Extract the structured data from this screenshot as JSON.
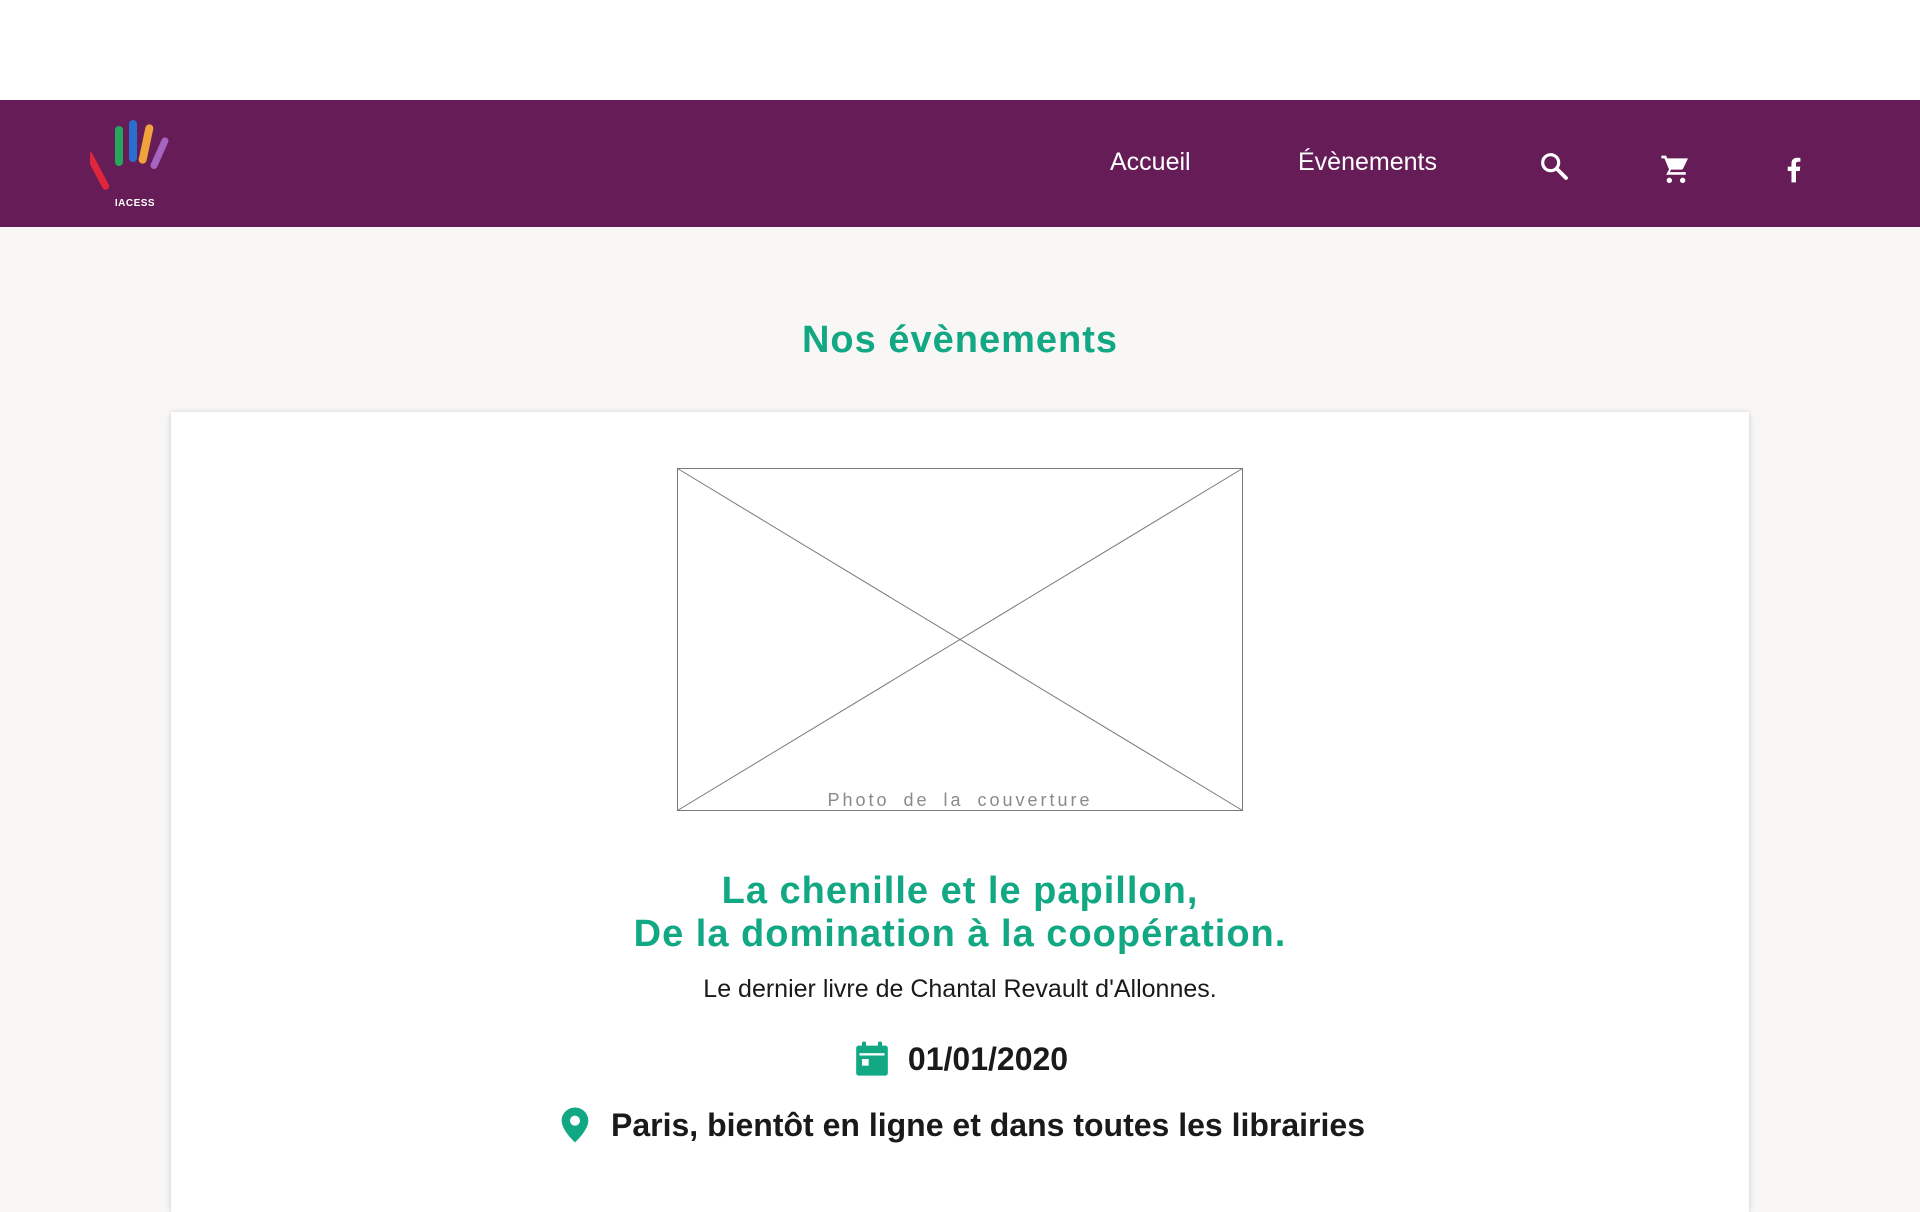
{
  "header": {
    "logo_text": "IACESS",
    "nav": {
      "home_label": "Accueil",
      "events_label": "Évènements"
    },
    "icons": {
      "search": "search-icon",
      "cart": "cart-icon",
      "facebook": "facebook-icon"
    }
  },
  "main": {
    "section_title": "Nos évènements",
    "event": {
      "cover_placeholder": "Photo de la couverture",
      "title_line1": "La chenille et le papillon,",
      "title_line2": "De la domination à la coopération.",
      "subtitle": "Le dernier livre de Chantal Revault d'Allonnes.",
      "date": "01/01/2020",
      "location": "Paris, bientôt en ligne et dans toutes les librairies"
    }
  },
  "colors": {
    "header_bg": "#661d57",
    "accent_green": "#13a884",
    "page_bg": "#f8f7f6"
  }
}
